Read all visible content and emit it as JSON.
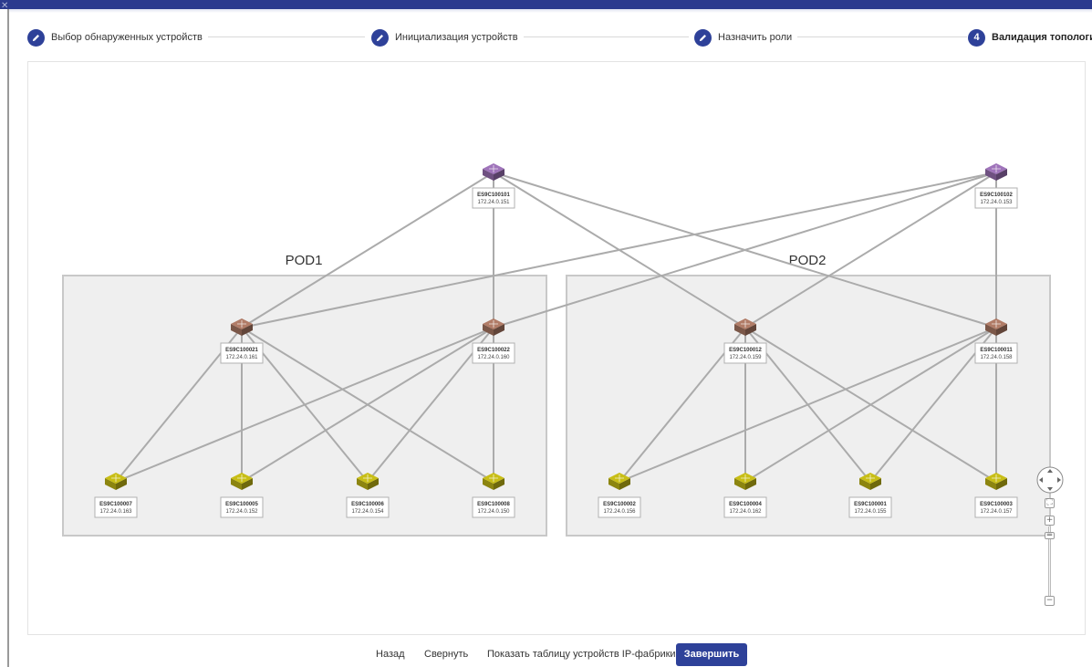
{
  "steps": [
    {
      "label": "Выбор обнаруженных устройств",
      "state": "done",
      "icon": "pencil-icon"
    },
    {
      "label": "Инициализация устройств",
      "state": "done",
      "icon": "pencil-icon"
    },
    {
      "label": "Назначить роли",
      "state": "done",
      "icon": "pencil-icon"
    },
    {
      "label": "Валидация топологии",
      "state": "active",
      "number": "4"
    }
  ],
  "topology": {
    "pods": [
      {
        "id": "pod1",
        "label": "POD1"
      },
      {
        "id": "pod2",
        "label": "POD2"
      }
    ],
    "devices": [
      {
        "id": "s1",
        "name": "ES9C100101",
        "ip": "172.24.0.151",
        "role": "super-spine",
        "color": "#8e68a6"
      },
      {
        "id": "s2",
        "name": "ES9C100102",
        "ip": "172.24.0.153",
        "role": "super-spine",
        "color": "#8e68a6"
      },
      {
        "id": "p21",
        "name": "ES9C100021",
        "ip": "172.24.0.161",
        "role": "spine",
        "color": "#9e6f5c"
      },
      {
        "id": "p22",
        "name": "ES9C100022",
        "ip": "172.24.0.160",
        "role": "spine",
        "color": "#9e6f5c"
      },
      {
        "id": "p12",
        "name": "ES9C100012",
        "ip": "172.24.0.159",
        "role": "spine",
        "color": "#9e6f5c"
      },
      {
        "id": "p11",
        "name": "ES9C100011",
        "ip": "172.24.0.158",
        "role": "spine",
        "color": "#9e6f5c"
      },
      {
        "id": "l7",
        "name": "ES9C100007",
        "ip": "172.24.0.163",
        "role": "leaf",
        "color": "#b3aa14"
      },
      {
        "id": "l5",
        "name": "ES9C100005",
        "ip": "172.24.0.152",
        "role": "leaf",
        "color": "#b3aa14"
      },
      {
        "id": "l6",
        "name": "ES9C100006",
        "ip": "172.24.0.154",
        "role": "leaf",
        "color": "#b3aa14"
      },
      {
        "id": "l8",
        "name": "ES9C100008",
        "ip": "172.24.0.150",
        "role": "leaf",
        "color": "#b3aa14"
      },
      {
        "id": "l2",
        "name": "ES9C100002",
        "ip": "172.24.0.156",
        "role": "leaf",
        "color": "#b3aa14"
      },
      {
        "id": "l4",
        "name": "ES9C100004",
        "ip": "172.24.0.162",
        "role": "leaf",
        "color": "#b3aa14"
      },
      {
        "id": "l1",
        "name": "ES9C100001",
        "ip": "172.24.0.155",
        "role": "leaf",
        "color": "#b3aa14"
      },
      {
        "id": "l3",
        "name": "ES9C100003",
        "ip": "172.24.0.157",
        "role": "leaf",
        "color": "#b3aa14"
      }
    ],
    "links": [
      [
        "s1",
        "p21"
      ],
      [
        "s1",
        "p22"
      ],
      [
        "s1",
        "p12"
      ],
      [
        "s1",
        "p11"
      ],
      [
        "s2",
        "p21"
      ],
      [
        "s2",
        "p22"
      ],
      [
        "s2",
        "p12"
      ],
      [
        "s2",
        "p11"
      ],
      [
        "p21",
        "l7"
      ],
      [
        "p21",
        "l5"
      ],
      [
        "p21",
        "l6"
      ],
      [
        "p21",
        "l8"
      ],
      [
        "p22",
        "l7"
      ],
      [
        "p22",
        "l5"
      ],
      [
        "p22",
        "l6"
      ],
      [
        "p22",
        "l8"
      ],
      [
        "p12",
        "l2"
      ],
      [
        "p12",
        "l4"
      ],
      [
        "p12",
        "l1"
      ],
      [
        "p12",
        "l3"
      ],
      [
        "p11",
        "l2"
      ],
      [
        "p11",
        "l4"
      ],
      [
        "p11",
        "l1"
      ],
      [
        "p11",
        "l3"
      ]
    ],
    "link_color": "#ababab",
    "pod_fill": "#efefef",
    "pod_border": "#c8c8c8"
  },
  "nav": {
    "fit_icon": "fit-screen-icon",
    "zoom_in": "+",
    "zoom_out": "−"
  },
  "footer": {
    "back": "Назад",
    "collapse": "Свернуть",
    "show_table": "Показать таблицу устройств IP-фабрики",
    "finish": "Завершить"
  },
  "colors": {
    "accent": "#2e4199",
    "topbar": "#2b3a8e"
  }
}
